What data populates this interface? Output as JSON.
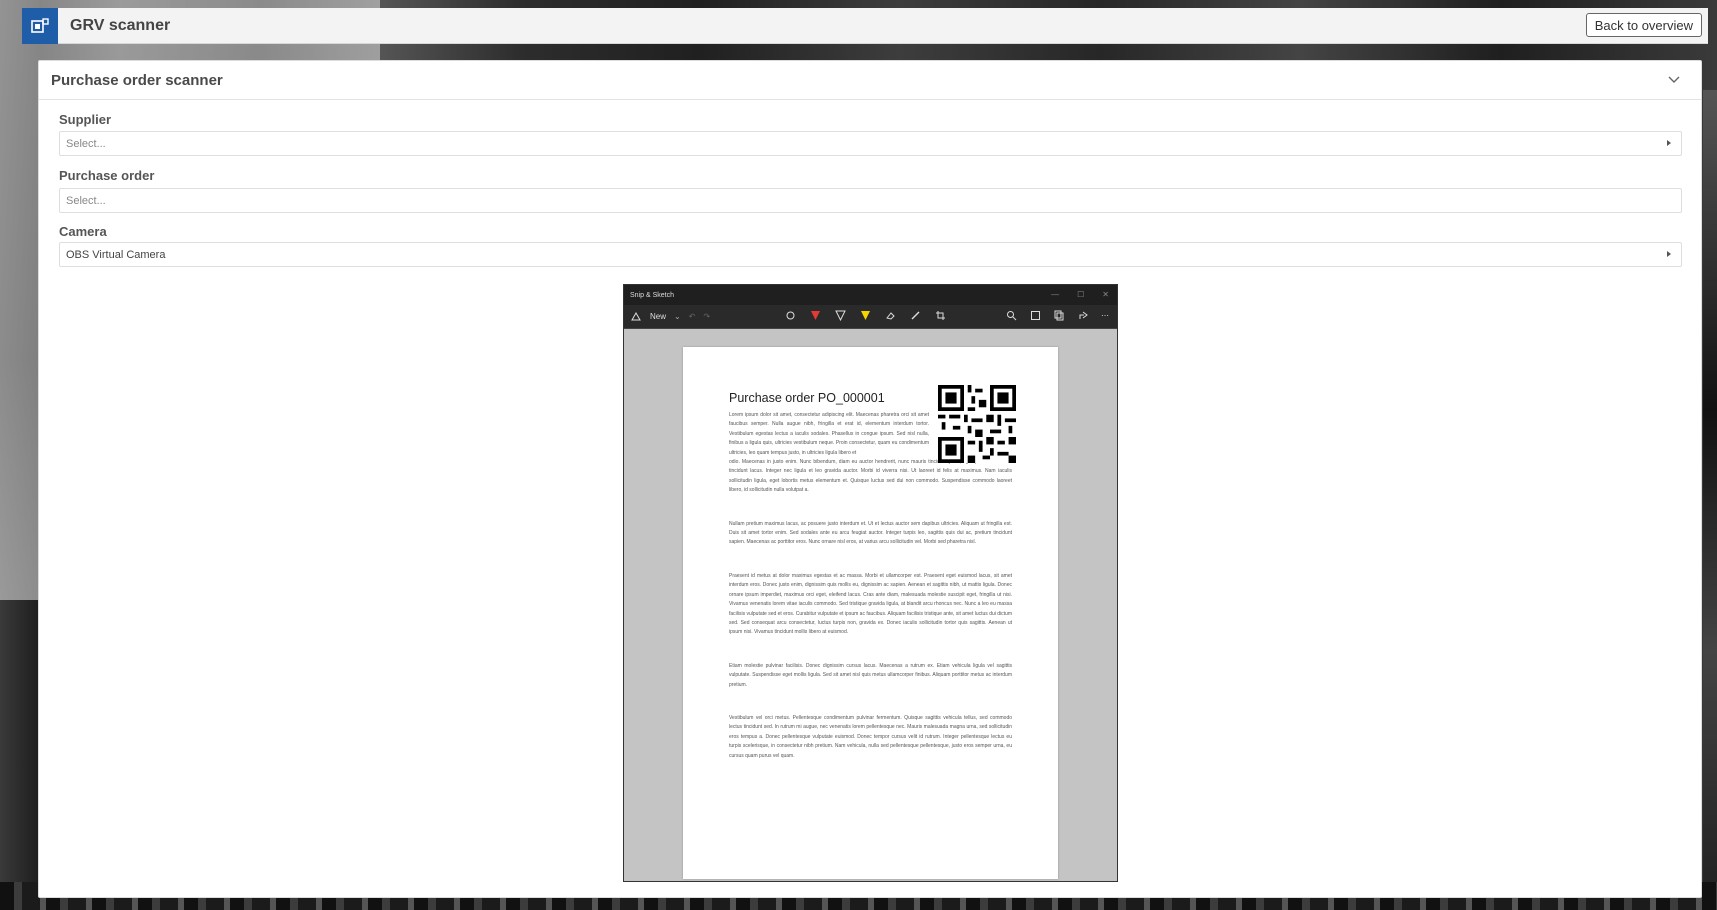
{
  "app": {
    "title": "GRV scanner",
    "back_label": "Back to overview"
  },
  "panel": {
    "title": "Purchase order scanner"
  },
  "fields": {
    "supplier": {
      "label": "Supplier",
      "placeholder": "Select..."
    },
    "purchase_order": {
      "label": "Purchase order",
      "placeholder": "Select..."
    },
    "camera": {
      "label": "Camera",
      "value": "OBS Virtual Camera"
    }
  },
  "preview": {
    "window_title": "Snip & Sketch",
    "new_label": "New",
    "document": {
      "title": "Purchase order PO_000001",
      "paragraphs": [
        "Lorem ipsum dolor sit amet, consectetur adipiscing elit. Maecenas pharetra orci sit amet faucibus semper. Nulla augue nibh, fringilla et erat id, elementum interdum tortor. Vestibulum egestas lectus a iaculis sodales. Phasellus in congue ipsum. Sed nisl nulla, finibus a ligula quis, ultricies vestibulum neque. Proin consectetur, quam eu condimentum ultricies, leo quam tempus justo, in ultricies ligula libero et",
        "odio. Maecenas in justo enim. Nunc bibendum, diam eu auctor hendrerit, nunc mauris tincidunt justo, eget placerat est felis tincidunt lacus. Integer nec ligula et leo gravida auctor. Morbi id viverra nisi. Ut laoreet id felis at maximus. Nam iaculis sollicitudin ligula, eget lobortis metus elementum et. Quisque luctus sed dui non commodo. Suspendisse commodo laoreet libero, id sollicitudin nulla volutpat a.",
        "Nullam pretium maximus lacus, ac posuere justo interdum et. Ut et lectus auctor sem dapibus ultricies. Aliquam ut fringilla est. Duis sit amet tortor enim. Sed sodales ante eu arcu feugiat auctor. Integer turpis leo, sagittis quis dui ac, pretium tincidunt sapien. Maecenas ac porttitor eros. Nunc ornare nisl eros, at varius arcu sollicitudin vel. Morbi sed pharetra nisl.",
        "Praesent id metus at dolor maximus egestas et ac massa. Morbi et ullamcorper est. Praesent eget euismod lacus, sit amet interdum eros. Donec justo enim, dignissim quis mollis eu, dignissim ac sapien. Aenean et sagittis nibh, ut mattis ligula. Donec ornare ipsum imperdiet, maximus orci eget, eleifend lacus. Cras ante diam, malesuada molestie suscipit eget, fringilla ut nisi. Vivamus venenatis lorem vitae iaculis commodo. Sed tristique gravida ligula, at blandit arcu rhoncus nec. Nunc a leo eu massa facilisis vulputate sed et eros. Curabitur vulputate et ipsum ac faucibus. Aliquam facilisis tristique ante, sit amet luctus dui dictum sed. Sed consequat arcu consectetur, luctus turpis non, gravida ex. Donec iaculis sollicitudin tortor quis sagittis. Aenean ut ipsum nisi. Vivamus tincidunt mollis libero at euismod.",
        "Etiam molestie pulvinar facilisis. Donec dignissim cursus lacus. Maecenas a rutrum ex. Etiam vehicula ligula vel sagittis vulputate. Suspendisse eget mollis ligula. Sed sit amet nisl quis metus ullamcorper finibus. Aliquam porttitor metus ac interdum pretium.",
        "Vestibulum vel orci metus. Pellentesque condimentum pulvinar fermentum. Quisque sagittis vehicula tellus, sed commodo lectus tincidunt sed. In rutrum mi augue, nec venenatis lorem pellentesque nec. Mauris malesuada magna urna, sed sollicitudin eros tempus a. Donec pellentesque vulputate euismod. Donec tempor cursus velit id rutrum. Integer pellentesque lectus eu turpis scelerisque, in consectetur nibh pretium. Nam vehicula, nulla sed pellentesque pellentesque, justo eros semper urna, eu cursus quam purus vel quam."
      ]
    }
  },
  "colors": {
    "accent": "#1f5da8",
    "panel_bg": "#ffffff",
    "topbar_bg": "#f3f3f3"
  }
}
